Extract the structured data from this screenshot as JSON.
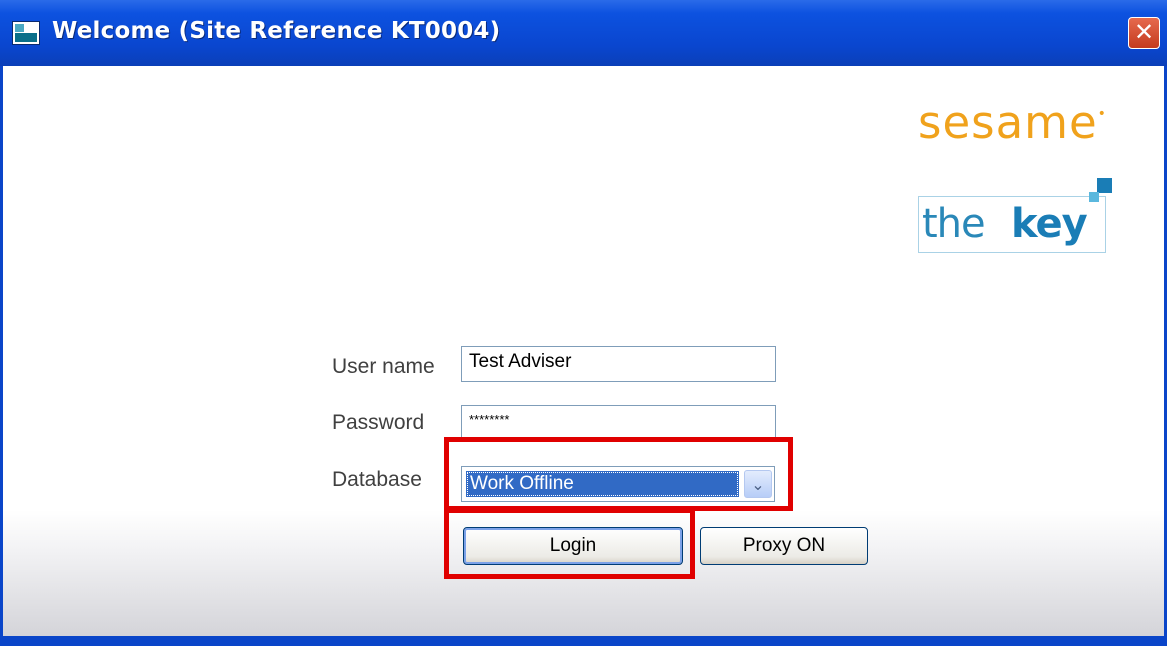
{
  "window": {
    "title": "Welcome (Site Reference KT0004)",
    "close_symbol": "✕"
  },
  "branding": {
    "sesame": "sesame",
    "sesame_mark": "•",
    "the_key_the": "the",
    "the_key_key": "key"
  },
  "form": {
    "username_label": "User name",
    "username_value": "Test Adviser",
    "password_label": "Password",
    "password_value": "********",
    "database_label": "Database",
    "database_value": "Work Offline",
    "dropdown_arrow": "⌄",
    "login_button": "Login",
    "proxy_button": "Proxy ON"
  },
  "annotations": {
    "highlight_color": "#e00000"
  }
}
